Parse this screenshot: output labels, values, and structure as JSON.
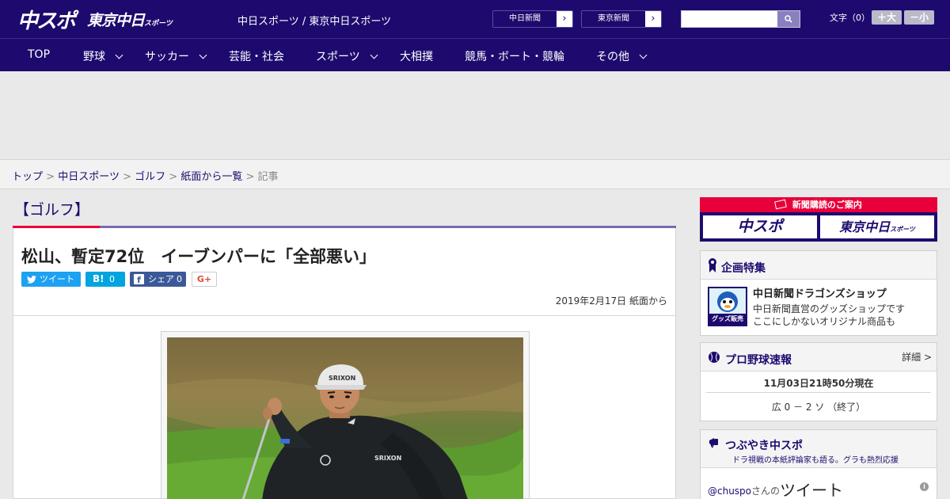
{
  "header": {
    "logo_main": "中スポ",
    "logo_tokyo": "東京中日",
    "logo_tokyo_small": "スポーツ",
    "site_title": "中日スポーツ / 東京中日スポーツ",
    "link_chunichi": "中日新聞",
    "link_tokyo": "東京新聞",
    "font_size_label": "文字（0）",
    "font_larger": "＋大",
    "font_smaller": "－小",
    "search_placeholder": ""
  },
  "nav": {
    "items": [
      {
        "label": "TOP",
        "has_dropdown": false
      },
      {
        "label": "野球",
        "has_dropdown": true
      },
      {
        "label": "サッカー",
        "has_dropdown": true
      },
      {
        "label": "芸能・社会",
        "has_dropdown": false
      },
      {
        "label": "スポーツ",
        "has_dropdown": true
      },
      {
        "label": "大相撲",
        "has_dropdown": false
      },
      {
        "label": "競馬・ボート・競輪",
        "has_dropdown": false
      },
      {
        "label": "その他",
        "has_dropdown": true
      }
    ]
  },
  "breadcrumb": {
    "items": [
      "トップ",
      "中日スポーツ",
      "ゴルフ",
      "紙面から一覧"
    ],
    "current": "記事",
    "separator": ">"
  },
  "article": {
    "category": "【ゴルフ】",
    "headline": "松山、暫定72位　イーブンパーに「全部悪い」",
    "share": {
      "tweet_label": "ツイート",
      "hatena_label": "B!",
      "hatena_count": "0",
      "facebook_label": "シェア",
      "facebook_count": "0",
      "gplus_label": "G+"
    },
    "date": "2019年2月17日 紙面から",
    "photo_cap_text": "SRIXON",
    "photo_chest_text": "SRIXON"
  },
  "sidebar": {
    "promo": {
      "title": "新聞購読のご案内",
      "left": "中スポ",
      "right": "東京中日",
      "right_small": "スポーツ"
    },
    "feature": {
      "title": "企画特集",
      "shop_title": "中日新聞ドラゴンズショップ",
      "shop_desc_1": "中日新聞直営のグッズショップです",
      "shop_desc_2": "ここにしかないオリジナル商品も",
      "thumb_label": "グッズ販売中"
    },
    "baseball": {
      "title": "プロ野球速報",
      "more": "詳細 >",
      "time": "11月03日21時50分現在",
      "score": "広 0 － 2 ソ （終了）"
    },
    "tweets": {
      "title": "つぶやき中スポ",
      "subtitle": "ドラ視戦の本紙評論家も語る。グラも熱烈応援",
      "handle": "@chuspo",
      "san": "さんの",
      "tweet_word": "ツイート"
    }
  },
  "colors": {
    "brand": "#1e0a6e",
    "accent_red": "#e8003a",
    "twitter": "#1da1f2",
    "hatena": "#00a4de",
    "facebook": "#3b5998"
  }
}
